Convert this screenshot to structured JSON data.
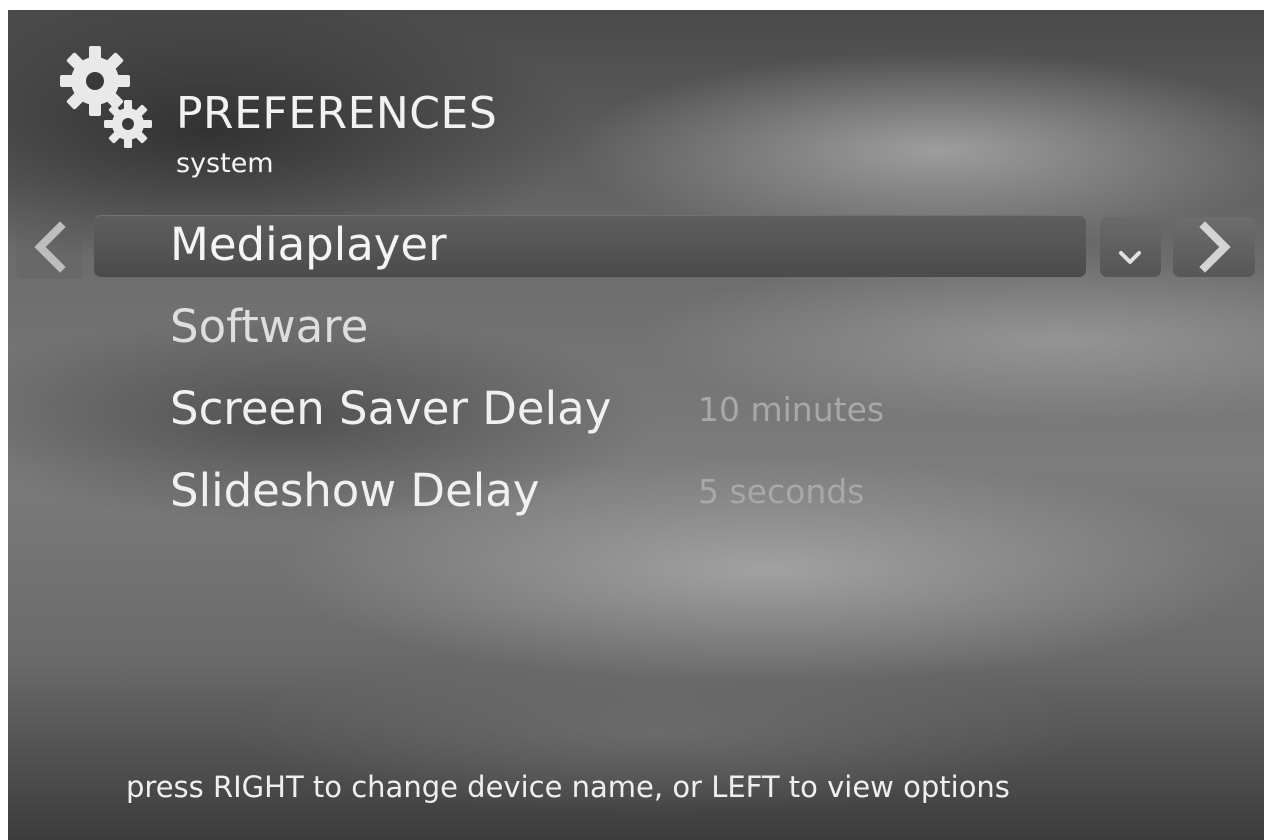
{
  "header": {
    "title": "PREFERENCES",
    "subtitle": "system",
    "icon": "gears-icon"
  },
  "menu": {
    "items": [
      {
        "label": "Mediaplayer",
        "value": "",
        "selected": true
      },
      {
        "label": "Software",
        "value": ""
      },
      {
        "label": "Screen Saver Delay",
        "value": "10 minutes"
      },
      {
        "label": "Slideshow Delay",
        "value": "5 seconds"
      }
    ]
  },
  "controls": {
    "left_icon": "chevron-left-icon",
    "right_icon": "chevron-right-icon",
    "dropdown_icon": "chevron-down-icon"
  },
  "footer": {
    "hint": "press RIGHT to change device name, or LEFT to view options"
  },
  "colors": {
    "text": "#f0f0f0",
    "value_text": "#a8a8a8",
    "highlight": "#555555"
  }
}
